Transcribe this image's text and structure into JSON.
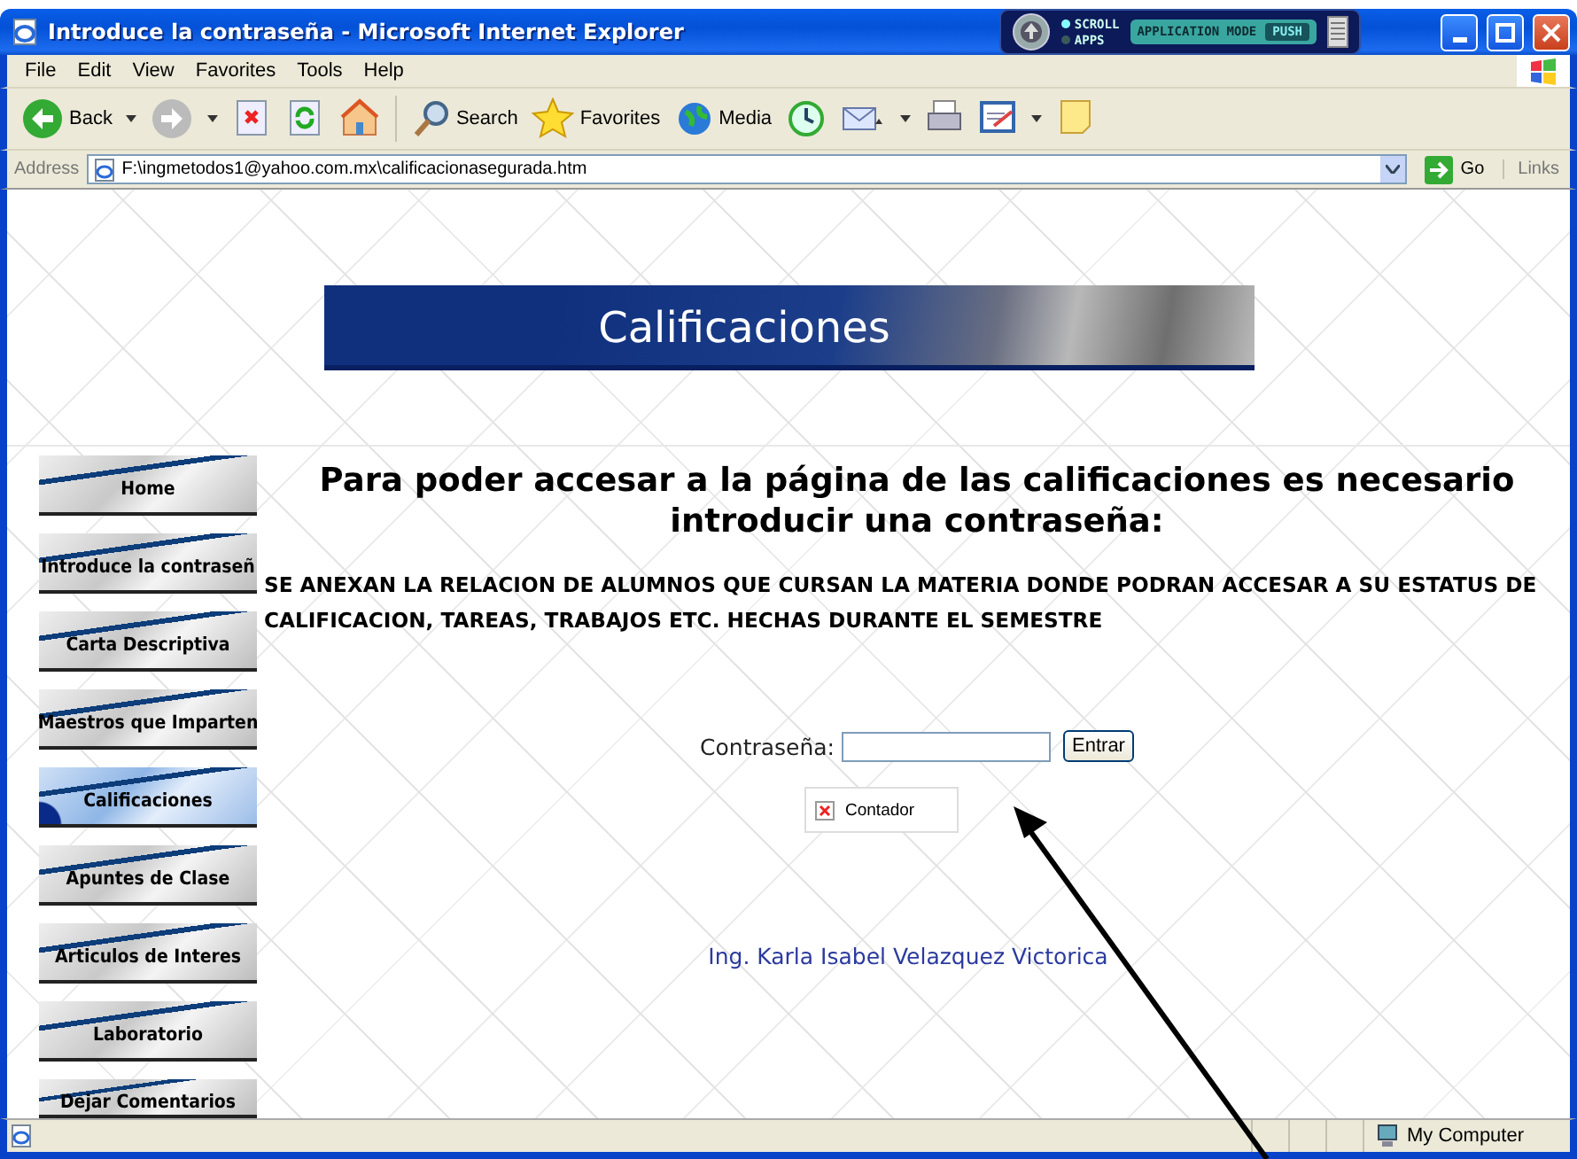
{
  "window": {
    "title": "Introduce la contraseña - Microsoft Internet Explorer"
  },
  "overlay_widget": {
    "options": [
      {
        "label": "SCROLL",
        "selected": true
      },
      {
        "label": "APPS",
        "selected": false
      }
    ],
    "mode": "APPLICATION MODE",
    "button": "PUSH"
  },
  "menu": [
    "File",
    "Edit",
    "View",
    "Favorites",
    "Tools",
    "Help"
  ],
  "toolbar": [
    {
      "kind": "back",
      "label": "Back"
    },
    {
      "kind": "forward"
    },
    {
      "kind": "stop"
    },
    {
      "kind": "refresh"
    },
    {
      "kind": "home"
    },
    {
      "kind": "search",
      "label": "Search"
    },
    {
      "kind": "favorites",
      "label": "Favorites"
    },
    {
      "kind": "media",
      "label": "Media"
    },
    {
      "kind": "history"
    },
    {
      "kind": "mail"
    },
    {
      "kind": "print"
    },
    {
      "kind": "edit"
    },
    {
      "kind": "note"
    }
  ],
  "address": {
    "label": "Address",
    "value": "F:\\ingmetodos1@yahoo.com.mx\\calificacionasegurada.htm",
    "go": "Go",
    "links": "Links"
  },
  "page": {
    "banner": "Calificaciones",
    "nav": [
      {
        "label": "Home",
        "selected": false
      },
      {
        "label": "Introduce la contraseñ",
        "selected": false
      },
      {
        "label": "Carta Descriptiva",
        "selected": false
      },
      {
        "label": "Maestros que Imparten",
        "selected": false
      },
      {
        "label": "Calificaciones",
        "selected": true
      },
      {
        "label": "Apuntes de Clase",
        "selected": false
      },
      {
        "label": "Articulos de Interes",
        "selected": false
      },
      {
        "label": "Laboratorio",
        "selected": false
      },
      {
        "label": "Dejar Comentarios",
        "selected": false
      }
    ],
    "heading": "Para poder accesar a la página de las calificaciones es necesario introducir una contraseña:",
    "notice": "SE ANEXAN LA RELACION DE ALUMNOS QUE CURSAN LA MATERIA DONDE PODRAN ACCESAR A SU ESTATUS DE CALIFICACION, TAREAS, TRABAJOS ETC. HECHAS DURANTE EL SEMESTRE",
    "password": {
      "label": "Contraseña:",
      "button": "Entrar"
    },
    "broken_image": "Contador",
    "author_link": "Ing. Karla Isabel Velazquez Victorica"
  },
  "status_bar": {
    "zone": "My Computer"
  }
}
